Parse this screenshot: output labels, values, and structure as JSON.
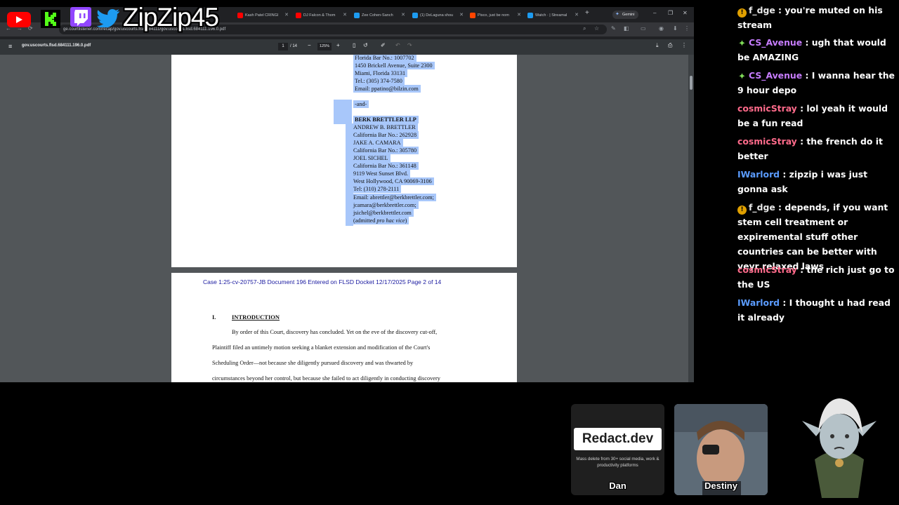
{
  "overlay": {
    "channel_name": "ZipZip45"
  },
  "browser": {
    "tabs": [
      {
        "label": "Kash Patel CRINGI",
        "color": "#ff0000"
      },
      {
        "label": "DJ Falcon & Thom",
        "color": "#ff0000"
      },
      {
        "label": "Zee Cohen-Sanch",
        "color": "#1d9bf0"
      },
      {
        "label": "(1) DeLaguna shou",
        "color": "#1d9bf0"
      },
      {
        "label": "Pisco, just be nom",
        "color": "#ff4500"
      },
      {
        "label": "Watch · | Streamal",
        "color": "#1d9bf0"
      }
    ],
    "new_tab": "+",
    "gemini_label": "Gemini",
    "address": "courtlistener.com/recap/gov.uscourts.flsd.684111/gov.uscourts.flsd.684111.196.0.pdf",
    "address_display": "ge.courtlistener.com/recap/gov.uscourts.flsd.684111/gov.uscourts.flsd.684111.196.0.pdf"
  },
  "pdf_toolbar": {
    "title": "gov.uscourts.flsd.684111.196.0.pdf",
    "current_page": "1",
    "total_pages": "/ 14",
    "zoom": "125%"
  },
  "page1": {
    "lines": [
      "Florida Bar No.: 1007702",
      "1450 Brickell Avenue, Suite 2300",
      "Miami, Florida 33131",
      "Tel.: (305) 374-7580",
      "Email: ppatino@bilzin.com",
      "-and-",
      "BERK BRETTLER LLP",
      "ANDREW B. BRETTLER",
      "California Bar No.: 262928",
      "JAKE A. CAMARA",
      "California Bar No.: 305780",
      "JOEL SICHEL",
      "California Bar No.: 361148",
      "9119 West Sunset Blvd.",
      "West Hollywood, CA 90069-3106",
      "Tel: (310) 278-2111",
      "Email: abrettler@berkbrettler.com;",
      "jcamara@berkbrettler.com;",
      "jsichel@berkbrettler.com"
    ],
    "last_line_prefix": "(admitted ",
    "last_line_italic": "pro hac vice",
    "last_line_suffix": ")"
  },
  "page2": {
    "header": "Case 1:25-cv-20757-JB   Document 196   Entered on FLSD Docket 12/17/2025   Page 2 of 14",
    "section_number": "I.",
    "section_title": "INTRODUCTION",
    "body_lines": [
      "By order of this Court, discovery has concluded. Yet on the eve of the discovery cut-off,",
      "Plaintiff filed an untimely motion seeking a blanket extension and modification of the Court's",
      "Scheduling Order—not because she diligently pursued discovery and was thwarted by",
      "circumstances beyond her control, but because she failed to act diligently in conducting discovery"
    ]
  },
  "chat": {
    "messages": [
      {
        "badge": "warn",
        "user": "f_dge",
        "color": "#e8e8e8",
        "text": "you're muted on his stream"
      },
      {
        "badge": "gem",
        "user": "CS_Avenue",
        "color": "#c77dff",
        "text": "ugh that would be AMAZING"
      },
      {
        "badge": "gem",
        "user": "CS_Avenue",
        "color": "#c77dff",
        "text": "I wanna hear the 9 hour depo"
      },
      {
        "badge": "",
        "user": "cosmicStray",
        "color": "#ff6b8b",
        "text": "lol yeah it would be a fun read"
      },
      {
        "badge": "",
        "user": "cosmicStray",
        "color": "#ff6b8b",
        "text": "the french do it better"
      },
      {
        "badge": "",
        "user": "IWarlord",
        "color": "#5b9cff",
        "text": "zipzip i was just gonna ask"
      },
      {
        "badge": "warn",
        "user": "f_dge",
        "color": "#e8e8e8",
        "text": "depends, if you want stem cell treatment or expiremental stuff other countries can be better with veyr relaxed laws"
      },
      {
        "badge": "",
        "user": "cosmicStray",
        "color": "#ff6b8b",
        "text": "the rich just go to the US"
      },
      {
        "badge": "",
        "user": "IWarlord",
        "color": "#5b9cff",
        "text": "I thought u had read it already"
      }
    ]
  },
  "cams": {
    "dan": "Dan",
    "destiny": "Destiny",
    "sponsor_logo": "Redact.dev",
    "sponsor_tagline": "Mass delete from 30+ social media, work & productivity platforms"
  }
}
